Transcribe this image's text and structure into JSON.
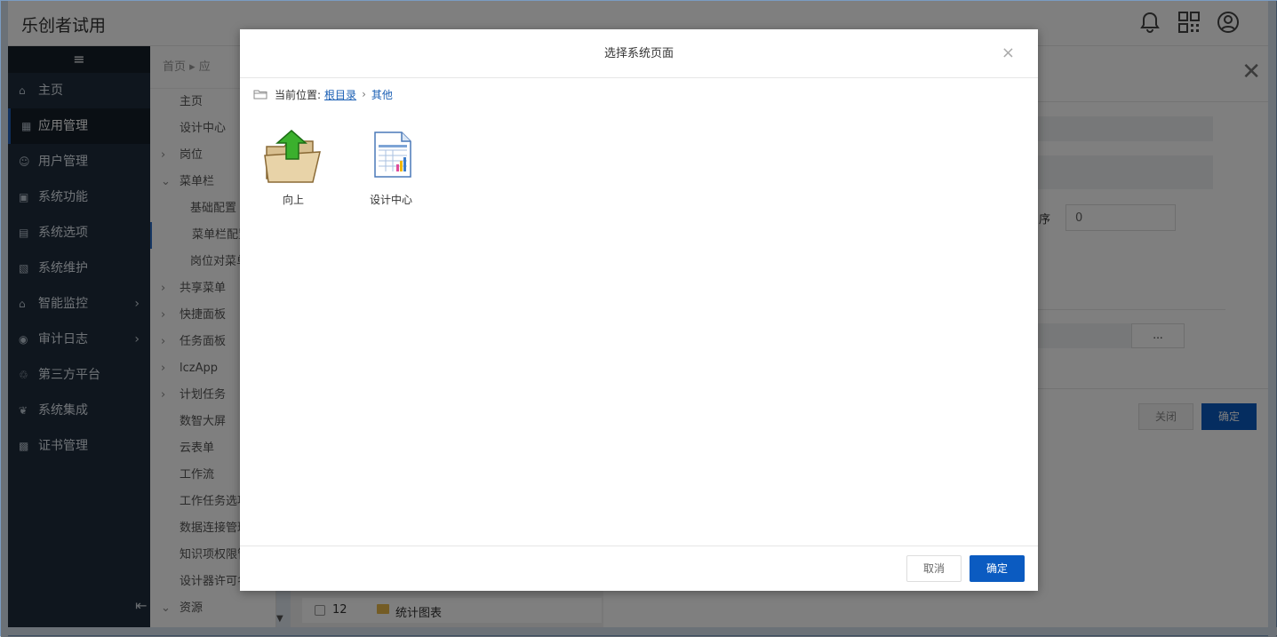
{
  "app": {
    "title": "乐创者试用"
  },
  "sidebar": {
    "toggle": "≡",
    "items": [
      {
        "label": "主页",
        "icon": "home-icon"
      },
      {
        "label": "应用管理",
        "icon": "apps-icon",
        "active": true
      },
      {
        "label": "用户管理",
        "icon": "users-icon"
      },
      {
        "label": "系统功能",
        "icon": "function-icon"
      },
      {
        "label": "系统选项",
        "icon": "options-icon"
      },
      {
        "label": "系统维护",
        "icon": "maintenance-icon"
      },
      {
        "label": "智能监控",
        "icon": "monitor-icon",
        "arrow": true
      },
      {
        "label": "审计日志",
        "icon": "eye-icon",
        "arrow": true
      },
      {
        "label": "第三方平台",
        "icon": "platform-icon"
      },
      {
        "label": "系统集成",
        "icon": "integration-icon"
      },
      {
        "label": "证书管理",
        "icon": "certificate-icon"
      }
    ]
  },
  "tree": {
    "breadcrumb": "首页 ▸ 应",
    "items": [
      {
        "label": "主页",
        "level": 0
      },
      {
        "label": "设计中心",
        "level": 0
      },
      {
        "label": "岗位",
        "level": 0,
        "caret": "›"
      },
      {
        "label": "菜单栏",
        "level": 0,
        "caret": "⌄"
      },
      {
        "label": "基础配置",
        "level": 1
      },
      {
        "label": "菜单栏配置",
        "level": 1,
        "selected": true
      },
      {
        "label": "岗位对菜单",
        "level": 1
      },
      {
        "label": "共享菜单",
        "level": 0,
        "caret": "›"
      },
      {
        "label": "快捷面板",
        "level": 0,
        "caret": "›"
      },
      {
        "label": "任务面板",
        "level": 0,
        "caret": "›"
      },
      {
        "label": "lczApp",
        "level": 0,
        "caret": "›"
      },
      {
        "label": "计划任务",
        "level": 0,
        "caret": "›"
      },
      {
        "label": "数智大屏",
        "level": 0
      },
      {
        "label": "云表单",
        "level": 0
      },
      {
        "label": "工作流",
        "level": 0
      },
      {
        "label": "工作任务选项",
        "level": 0
      },
      {
        "label": "数据连接管理",
        "level": 0
      },
      {
        "label": "知识项权限管",
        "level": 0
      },
      {
        "label": "设计器许可名",
        "level": 0
      },
      {
        "label": "资源",
        "level": 0,
        "caret": "⌄"
      }
    ]
  },
  "list": {
    "row_no": "12",
    "row_label": "统计图表"
  },
  "right_panel": {
    "sort_label": "序",
    "sort_value": "0",
    "ellipsis": "...",
    "close_label": "关闭",
    "ok_label": "确定"
  },
  "modal": {
    "title": "选择系统页面",
    "close": "×",
    "path_prefix": "当前位置:",
    "path_root": "根目录",
    "path_sep": "›",
    "path_current": "其他",
    "tiles": [
      {
        "label": "向上",
        "icon": "folder-up-icon"
      },
      {
        "label": "设计中心",
        "icon": "report-page-icon"
      }
    ],
    "cancel_label": "取消",
    "ok_label": "确定"
  }
}
